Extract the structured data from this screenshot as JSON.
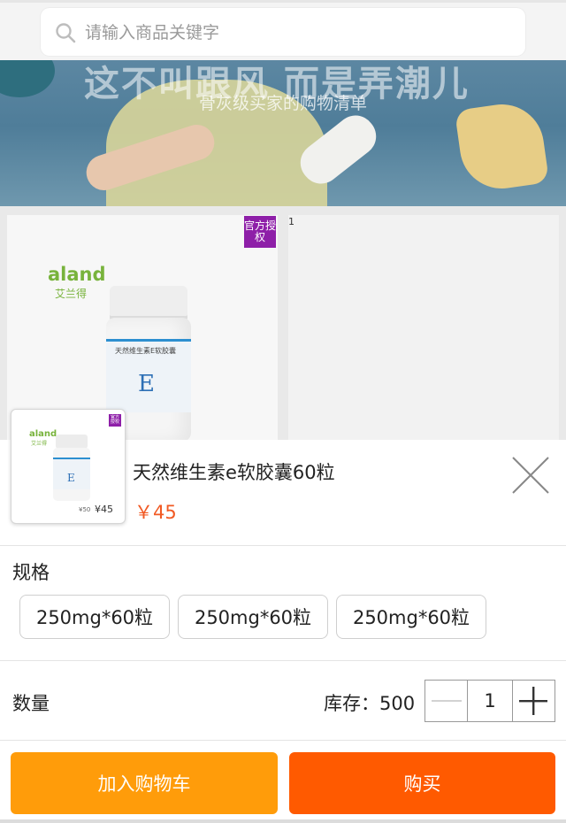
{
  "search": {
    "placeholder": "请输入商品关键字"
  },
  "banner": {
    "headline": "这不叫跟风 而是弄潮儿",
    "subline": "骨灰级买家的购物清单"
  },
  "grid": {
    "brand": "aland",
    "brand_cn": "艾兰得",
    "badge": "官方授权",
    "page_index": "1",
    "jar_label": "天然维生素E软胶囊",
    "jar_letter": "E"
  },
  "sheet": {
    "thumb": {
      "brand": "aland",
      "brand_cn": "艾兰得",
      "badge": "官方授权",
      "old_price": "¥50",
      "price": "¥45",
      "letter": "E"
    },
    "product_title": "天然维生素e软胶囊60粒",
    "price": "￥45",
    "spec_label": "规格",
    "specs": [
      "250mg*60粒",
      "250mg*60粒",
      "250mg*60粒"
    ],
    "quantity_label": "数量",
    "stock_text": "库存：500",
    "quantity_value": "1",
    "add_to_cart": "加入购物车",
    "buy_now": "购买"
  },
  "colors": {
    "accent_orange": "#ff9c0a",
    "buy_red": "#ff5a00",
    "price": "#f15a24",
    "badge_purple": "#8e1fa8"
  }
}
